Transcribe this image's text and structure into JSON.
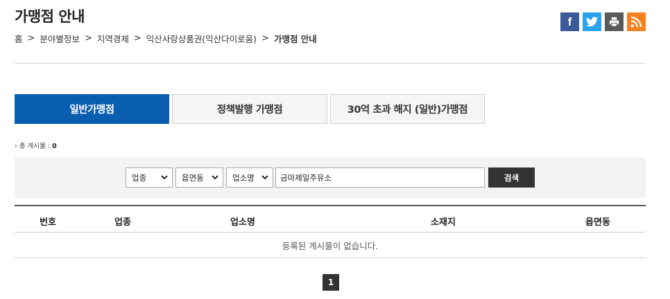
{
  "header": {
    "title": "가맹점 안내",
    "breadcrumb": [
      "홈",
      "분야별정보",
      "지역경제",
      "익산사랑상품권(익산다이로움)",
      "가맹점 안내"
    ]
  },
  "share": {
    "icons": [
      "facebook-icon",
      "twitter-icon",
      "print-icon",
      "rss-icon"
    ],
    "facebook_label": "f",
    "colors": {
      "facebook": "#3b5a9a",
      "twitter": "#2aa3ef",
      "print": "#5a5a5a",
      "rss": "#f5821f"
    }
  },
  "tabs": [
    {
      "label": "일반가맹점",
      "active": true
    },
    {
      "label": "정책발행 가맹점",
      "active": false
    },
    {
      "label": "30억 초과 해지 (일반)가맹점",
      "active": false
    }
  ],
  "total": {
    "label": "총 게시물 : ",
    "count": "0"
  },
  "search": {
    "category_select": "업종",
    "district_select": "읍면동",
    "field_select": "업소명",
    "keyword": "금마제일주유소",
    "button_label": "검색"
  },
  "table": {
    "columns": [
      "번호",
      "업종",
      "업소명",
      "소재지",
      "읍면동"
    ],
    "empty_message": "등록된 게시물이 없습니다."
  },
  "pagination": {
    "current_page": "1"
  },
  "colors": {
    "accent": "#0a5eb0",
    "dark_button": "#333333"
  }
}
